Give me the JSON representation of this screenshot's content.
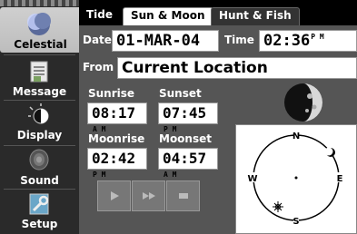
{
  "sidebar": {
    "items": [
      {
        "label": "Celestial",
        "icon": "moon-icon"
      },
      {
        "label": "Message",
        "icon": "envelope-icon"
      },
      {
        "label": "Display",
        "icon": "contrast-icon"
      },
      {
        "label": "Sound",
        "icon": "speaker-icon"
      },
      {
        "label": "Setup",
        "icon": "wrench-icon"
      }
    ]
  },
  "tabs": [
    {
      "label": "Tide"
    },
    {
      "label": "Sun & Moon"
    },
    {
      "label": "Hunt & Fish"
    }
  ],
  "main": {
    "date_label": "Date",
    "date_value": "01-MAR-04",
    "time_label": "Time",
    "time_value": "02:36",
    "time_ampm": "P M",
    "from_label": "From",
    "from_value": "Current Location",
    "sunrise_label": "Sunrise",
    "sunrise_value": "08:17",
    "sunrise_ampm": "A M",
    "sunset_label": "Sunset",
    "sunset_value": "07:45",
    "sunset_ampm": "P M",
    "moonrise_label": "Moonrise",
    "moonrise_value": "02:42",
    "moonrise_ampm": "P M",
    "moonset_label": "Moonset",
    "moonset_value": "04:57",
    "moonset_ampm": "A M"
  },
  "sky": {
    "north": "N",
    "south": "S",
    "east": "E",
    "west": "W"
  },
  "controls": {
    "play_icon": "play-icon",
    "fast_forward_icon": "fast-forward-icon",
    "stop_icon": "stop-icon"
  }
}
